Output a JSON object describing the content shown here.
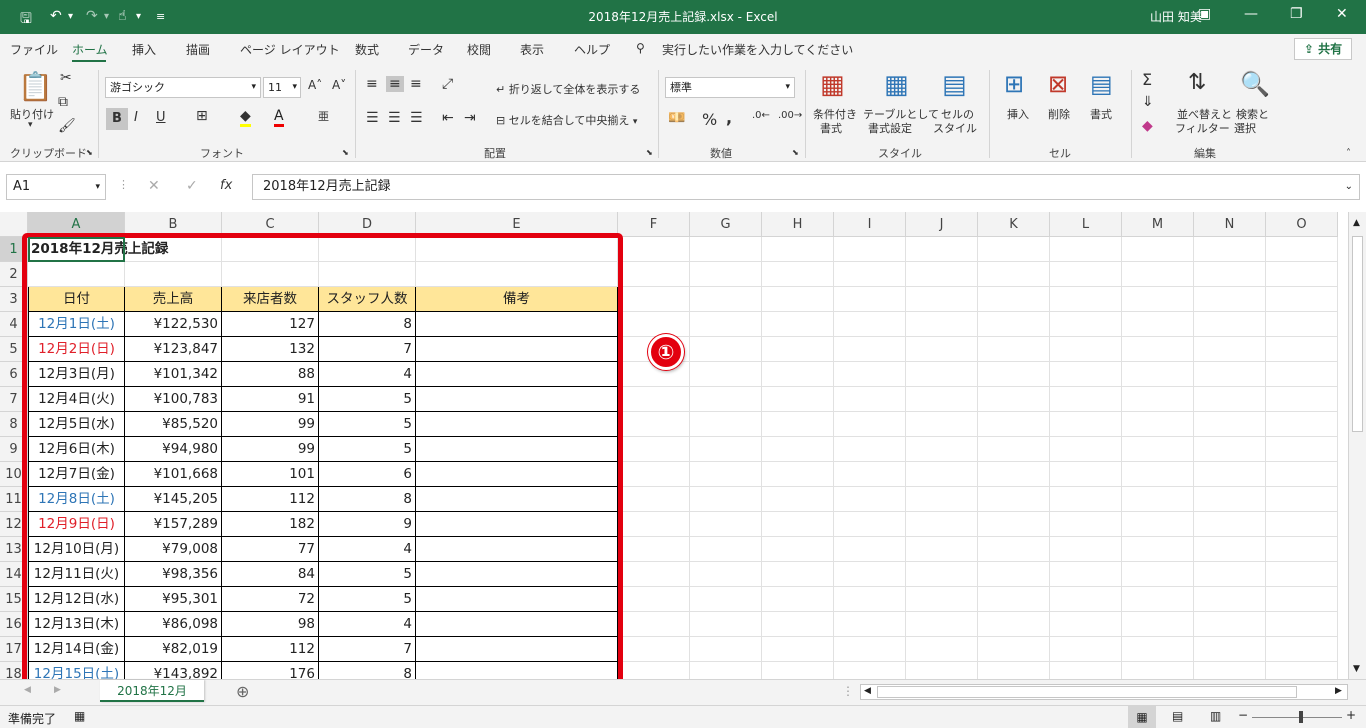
{
  "window": {
    "title": "2018年12月売上記録.xlsx  -  Excel",
    "user": "山田 知美"
  },
  "menu": {
    "items": [
      "ファイル",
      "ホーム",
      "挿入",
      "描画",
      "ページ レイアウト",
      "数式",
      "データ",
      "校閲",
      "表示",
      "ヘルプ"
    ],
    "tell_me": "実行したい作業を入力してください",
    "share": "共有"
  },
  "ribbon": {
    "groups": {
      "clipboard": "クリップボード",
      "font": "フォント",
      "alignment": "配置",
      "number": "数値",
      "styles": "スタイル",
      "cells": "セル",
      "editing": "編集"
    },
    "paste": "貼り付け",
    "font_name": "游ゴシック",
    "font_size": "11",
    "wrap_text": "折り返して全体を表示する",
    "merge_center": "セルを結合して中央揃え",
    "number_format": "標準",
    "cond_format": "条件付き",
    "cond_format2": "書式",
    "table_format": "テーブルとして",
    "table_format2": "書式設定",
    "cell_styles": "セルの",
    "cell_styles2": "スタイル",
    "insert": "挿入",
    "delete": "削除",
    "format": "書式",
    "sort_filter": "並べ替えと",
    "sort_filter2": "フィルター",
    "find_select": "検索と",
    "find_select2": "選択",
    "bold": "B",
    "italic": "I",
    "underline": "U"
  },
  "formula_bar": {
    "name_box": "A1",
    "formula": "2018年12月売上記録",
    "fx": "fx"
  },
  "columns": [
    "A",
    "B",
    "C",
    "D",
    "E",
    "F",
    "G",
    "H",
    "I",
    "J",
    "K",
    "L",
    "M",
    "N",
    "O"
  ],
  "rows": [
    "1",
    "2",
    "3",
    "4",
    "5",
    "6",
    "7",
    "8",
    "9",
    "10",
    "11",
    "12",
    "13",
    "14",
    "15",
    "16",
    "17",
    "18"
  ],
  "sheet": {
    "title": "2018年12月売上記録",
    "headers": [
      "日付",
      "売上高",
      "来店者数",
      "スタッフ人数",
      "備考"
    ],
    "data": [
      {
        "date": "12月1日(土)",
        "sales": "¥122,530",
        "visitors": "127",
        "staff": "8",
        "color": "blue"
      },
      {
        "date": "12月2日(日)",
        "sales": "¥123,847",
        "visitors": "132",
        "staff": "7",
        "color": "red"
      },
      {
        "date": "12月3日(月)",
        "sales": "¥101,342",
        "visitors": "88",
        "staff": "4",
        "color": ""
      },
      {
        "date": "12月4日(火)",
        "sales": "¥100,783",
        "visitors": "91",
        "staff": "5",
        "color": ""
      },
      {
        "date": "12月5日(水)",
        "sales": "¥85,520",
        "visitors": "99",
        "staff": "5",
        "color": ""
      },
      {
        "date": "12月6日(木)",
        "sales": "¥94,980",
        "visitors": "99",
        "staff": "5",
        "color": ""
      },
      {
        "date": "12月7日(金)",
        "sales": "¥101,668",
        "visitors": "101",
        "staff": "6",
        "color": ""
      },
      {
        "date": "12月8日(土)",
        "sales": "¥145,205",
        "visitors": "112",
        "staff": "8",
        "color": "blue"
      },
      {
        "date": "12月9日(日)",
        "sales": "¥157,289",
        "visitors": "182",
        "staff": "9",
        "color": "red"
      },
      {
        "date": "12月10日(月)",
        "sales": "¥79,008",
        "visitors": "77",
        "staff": "4",
        "color": ""
      },
      {
        "date": "12月11日(火)",
        "sales": "¥98,356",
        "visitors": "84",
        "staff": "5",
        "color": ""
      },
      {
        "date": "12月12日(水)",
        "sales": "¥95,301",
        "visitors": "72",
        "staff": "5",
        "color": ""
      },
      {
        "date": "12月13日(木)",
        "sales": "¥86,098",
        "visitors": "98",
        "staff": "4",
        "color": ""
      },
      {
        "date": "12月14日(金)",
        "sales": "¥82,019",
        "visitors": "112",
        "staff": "7",
        "color": ""
      },
      {
        "date": "12月15日(土)",
        "sales": "¥143,892",
        "visitors": "176",
        "staff": "8",
        "color": "blue"
      }
    ]
  },
  "annotation": {
    "label": "①",
    "color": "#e3000f"
  },
  "sheet_tabs": {
    "active": "2018年12月"
  },
  "status": {
    "text": "準備完了"
  },
  "colors": {
    "brand": "#217346",
    "header_fill": "#ffe699",
    "saturday": "#2e75b6",
    "sunday": "#e0202a"
  }
}
